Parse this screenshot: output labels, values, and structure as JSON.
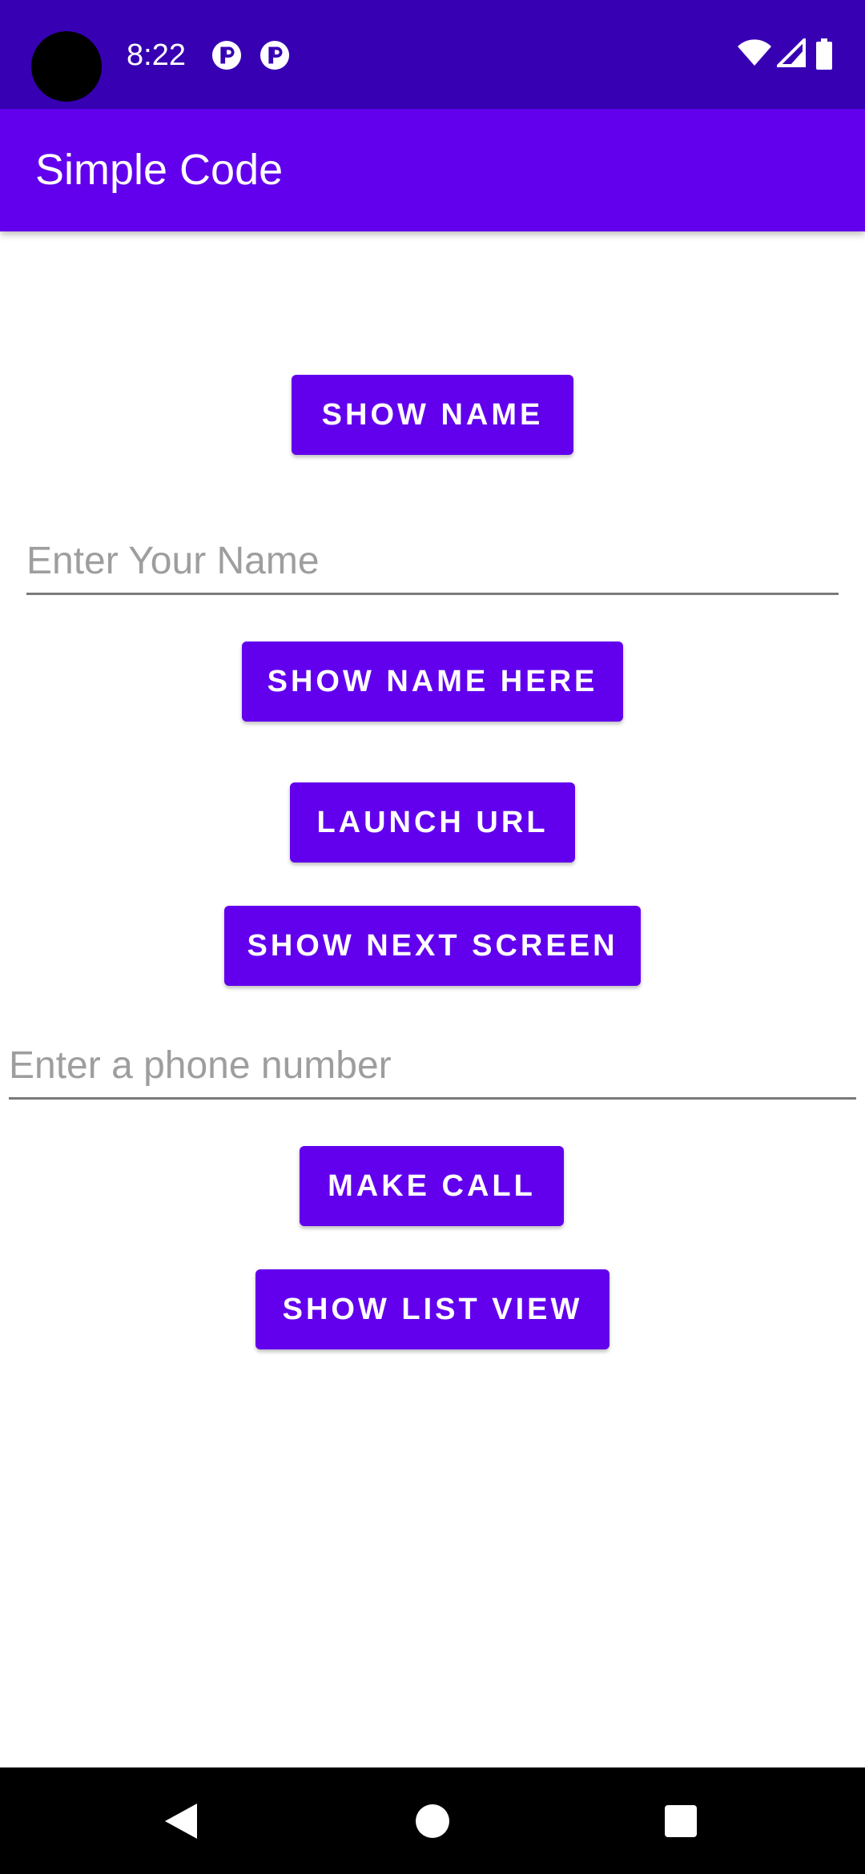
{
  "status_bar": {
    "time": "8:22",
    "icons": [
      "notification-p-icon",
      "notification-p-icon",
      "wifi-icon",
      "signal-icon",
      "battery-icon"
    ]
  },
  "app_bar": {
    "title": "Simple Code"
  },
  "buttons": {
    "show_name": "SHOW NAME",
    "show_name_here": "SHOW NAME HERE",
    "launch_url": "LAUNCH URL",
    "show_next_screen": "SHOW NEXT SCREEN",
    "make_call": "MAKE CALL",
    "show_list_view": "SHOW LIST VIEW"
  },
  "inputs": {
    "name": {
      "value": "",
      "placeholder": "Enter Your Name"
    },
    "phone": {
      "value": "",
      "placeholder": "Enter a phone number"
    }
  },
  "nav_bar": {
    "icons": [
      "back-icon",
      "home-icon",
      "recents-icon"
    ]
  },
  "colors": {
    "status_bar": "#3700b3",
    "primary": "#6200ee",
    "nav_bar": "#000000"
  }
}
